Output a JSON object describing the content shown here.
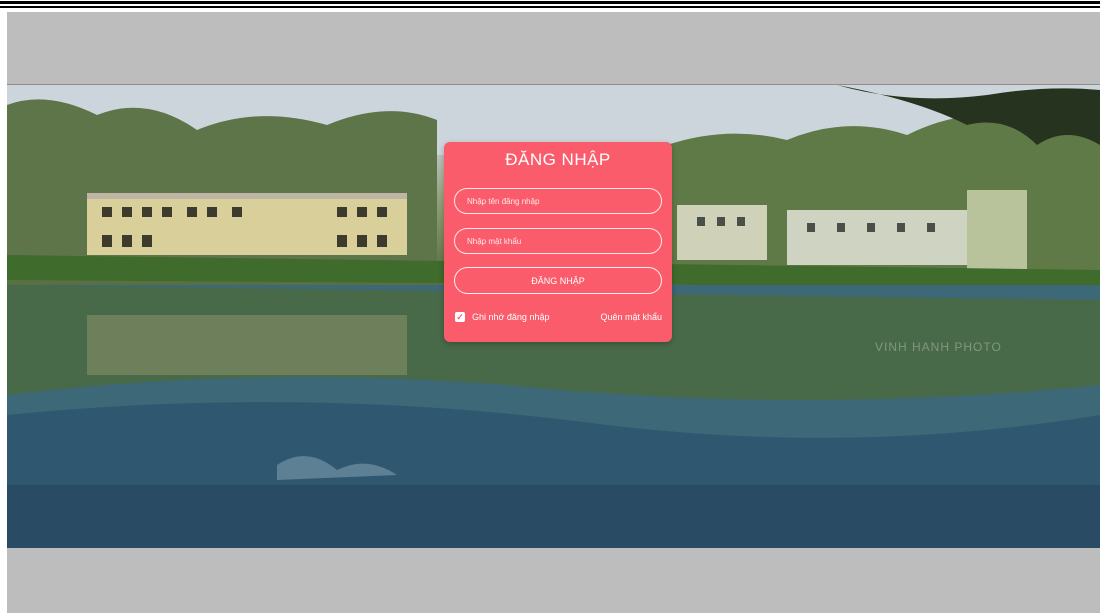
{
  "login": {
    "title": "ĐĂNG NHẬP",
    "username_placeholder": "Nhập tên đăng nhập",
    "password_placeholder": "Nhập mật khẩu",
    "submit_label": "ĐĂNG NHẬP",
    "remember_label": "Ghi nhớ đăng nhập",
    "remember_checked": true,
    "forgot_label": "Quên mật khẩu"
  },
  "banner": {
    "watermark": "VINH HANH PHOTO"
  },
  "colors": {
    "card": "#fb5c6b",
    "page_background": "#bdbdbd"
  }
}
